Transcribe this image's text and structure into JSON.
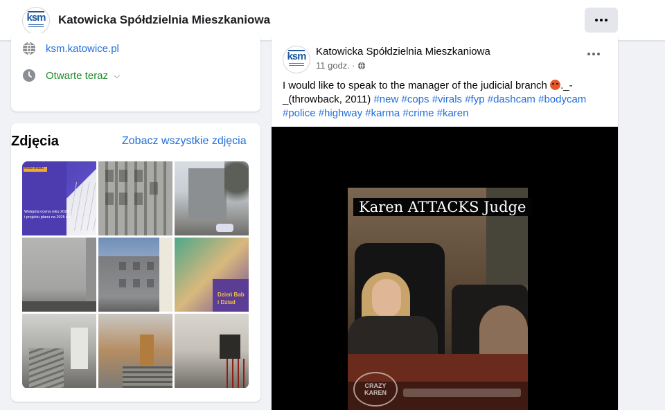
{
  "header": {
    "page_name": "Katowicka Spółdzielnia Mieszkaniowa",
    "logo_text": "ksm",
    "more_icon": "three-dots-icon"
  },
  "intro": {
    "website": "ksm.katowice.pl",
    "hours_status": "Otwarte teraz",
    "icons": [
      "globe-icon",
      "clock-icon",
      "chevron-down-icon"
    ]
  },
  "photos": {
    "title": "Zdjęcia",
    "see_all": "Zobacz wszystkie zdjęcia",
    "tile1_tag": "mulat składu",
    "tile1_lines": [
      "Wstępna ocena roku 2024",
      "i projektu planu na 2025 rok"
    ],
    "tile6_lines": [
      "Dzień Bab",
      "i Dziad"
    ]
  },
  "post": {
    "author": "Katowicka Spółdzielnia Mieszkaniowa",
    "time": "11 godz.",
    "separator": "·",
    "text_before_emoji": "I would like to speak to the manager of the judicial branch ",
    "text_after_emoji": "._-_(throwback, 2011)",
    "hashtags": "#new #cops #virals #fyp #dashcam #bodycam #police #highway #karma #crime #karen",
    "video_caption": "Karen ATTACKS Judge",
    "watermark": "CRAZY KAREN",
    "colors": {
      "link": "#216fdb",
      "open": "#1e8a2a",
      "brand": "#1f5a9e"
    }
  }
}
